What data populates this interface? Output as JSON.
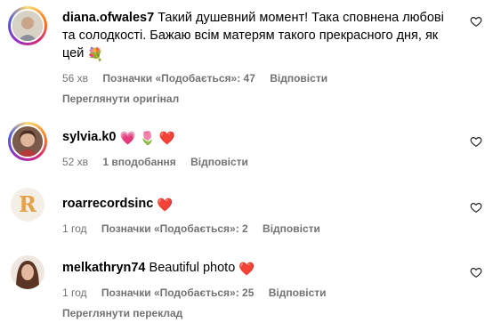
{
  "comments": [
    {
      "username": "diana.ofwales7",
      "text": "Такий душевний момент! Така сповнена любові та солодкості. Бажаю всім матерям такого прекрасного дня, як цей",
      "emoji": "💐",
      "time": "56 хв",
      "likes": "Позначки «Подобається»: 47",
      "reply": "Відповісти",
      "extra": "Переглянути оригінал"
    },
    {
      "username": "sylvia.k0",
      "text": "",
      "emoji": "💗 🌷 ❤️",
      "time": "52 хв",
      "likes": "1 вподобання",
      "reply": "Відповісти",
      "extra": ""
    },
    {
      "username": "roarrecordsinc",
      "text": "",
      "emoji": "❤️",
      "time": "1 год",
      "likes": "Позначки «Подобається»: 2",
      "reply": "Відповісти",
      "extra": ""
    },
    {
      "username": "melkathryn74",
      "text": "Beautiful photo",
      "emoji": "❤️",
      "time": "1 год",
      "likes": "Позначки «Подобається»: 25",
      "reply": "Відповісти",
      "extra": "Переглянути переклад"
    }
  ],
  "icons": {
    "like": "heart-outline-icon"
  },
  "colors": {
    "meta_text": "#737373",
    "heart": "#ed4956"
  }
}
